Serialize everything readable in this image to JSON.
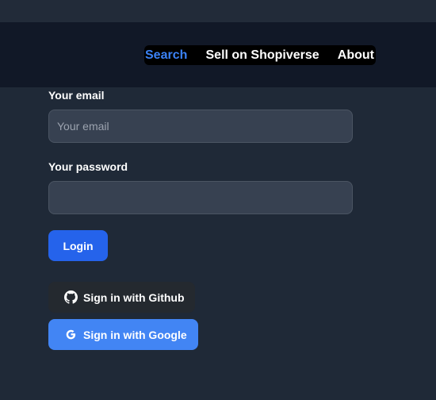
{
  "nav": {
    "links": [
      {
        "label": "Search",
        "active": true
      },
      {
        "label": "Sell on Shopiverse",
        "active": false
      },
      {
        "label": "About",
        "active": false
      }
    ]
  },
  "form": {
    "email_label": "Your email",
    "email_placeholder": "Your email",
    "email_value": "",
    "password_label": "Your password",
    "password_value": "",
    "login_label": "Login",
    "github_label": "Sign in with Github",
    "google_label": "Sign in with Google"
  },
  "icons": {
    "github": "github-icon",
    "google": "google-icon"
  },
  "colors": {
    "page_background": "#1f2937",
    "navbar_background": "#111827",
    "active_link": "#3b82f6",
    "login_button": "#2563eb",
    "github_button": "#24292f",
    "google_button": "#4285f4",
    "input_background": "#374151"
  }
}
